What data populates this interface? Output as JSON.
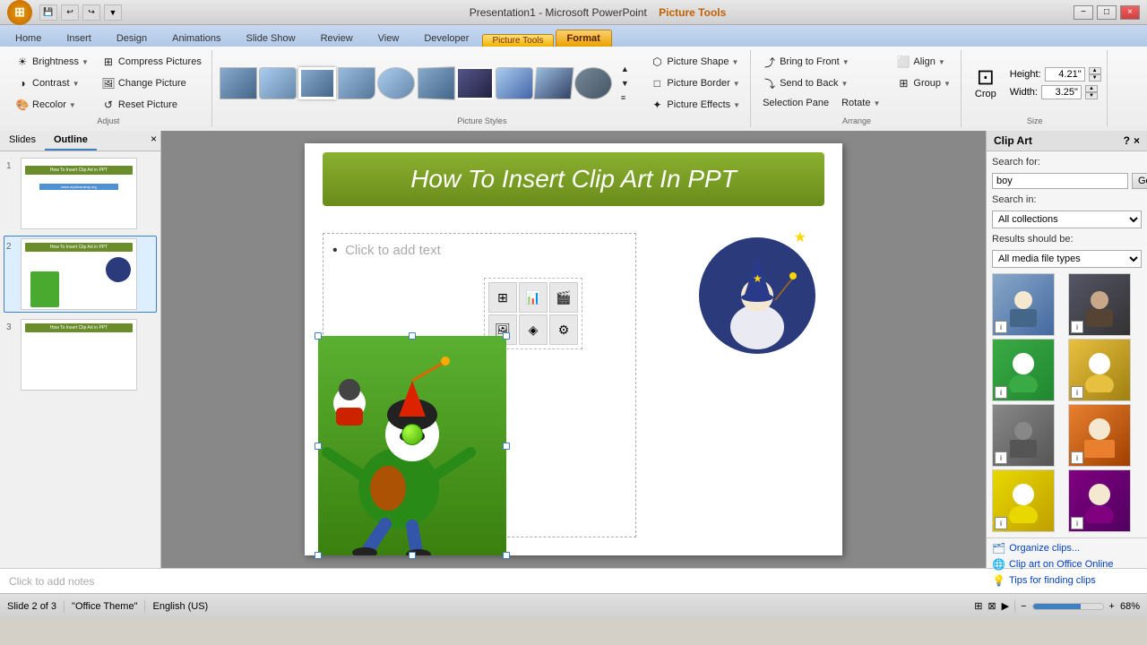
{
  "titlebar": {
    "app_name": "Presentation1 - Microsoft PowerPoint",
    "picture_tools": "Picture Tools",
    "min_label": "−",
    "max_label": "□",
    "close_label": "×"
  },
  "tabs": {
    "items": [
      "Home",
      "Insert",
      "Design",
      "Animations",
      "Slide Show",
      "Review",
      "View",
      "Developer",
      "Format"
    ],
    "active": "Format",
    "picture_tools_label": "Picture Tools"
  },
  "ribbon": {
    "adjust_group": "Adjust",
    "styles_group": "Picture Styles",
    "arrange_group": "Arrange",
    "size_group": "Size",
    "brightness_label": "Brightness",
    "contrast_label": "Contrast",
    "recolor_label": "Recolor",
    "compress_label": "Compress Pictures",
    "change_label": "Change Picture",
    "reset_label": "Reset Picture",
    "shape_label": "Picture Shape",
    "border_label": "Picture Border",
    "effects_label": "Picture Effects",
    "bring_front_label": "Bring to Front",
    "send_back_label": "Send to Back",
    "selection_pane_label": "Selection Pane",
    "rotate_label": "Rotate",
    "align_label": "Align",
    "group_label": "Group",
    "height_label": "Height:",
    "height_value": "4.21\"",
    "width_label": "Width:",
    "width_value": "3.25\"",
    "crop_label": "Crop"
  },
  "slides_panel": {
    "slides_tab": "Slides",
    "outline_tab": "Outline",
    "slides": [
      {
        "num": "1",
        "title": "How To Insert Clip Art in PPT",
        "url": "www.myslicecamp.org"
      },
      {
        "num": "2",
        "title": "How To Insert Clip Art in PPT"
      },
      {
        "num": "3",
        "title": "How To Insert Clip Art in PPT"
      }
    ]
  },
  "slide": {
    "heading": "How To Insert Clip Art In PPT",
    "text_placeholder": "Click to add text",
    "notes_placeholder": "Click to add notes"
  },
  "clipart_panel": {
    "title": "Clip Art",
    "search_label": "Search for:",
    "search_value": "boy",
    "go_label": "Go",
    "search_in_label": "Search in:",
    "search_in_value": "All collections",
    "results_label": "Results should be:",
    "results_value": "All media file types",
    "organize_label": "Organize clips...",
    "office_online_label": "Clip art on Office Online",
    "tips_label": "Tips for finding clips"
  },
  "statusbar": {
    "slide_info": "Slide 2 of 3",
    "theme": "\"Office Theme\"",
    "zoom": "68%"
  }
}
